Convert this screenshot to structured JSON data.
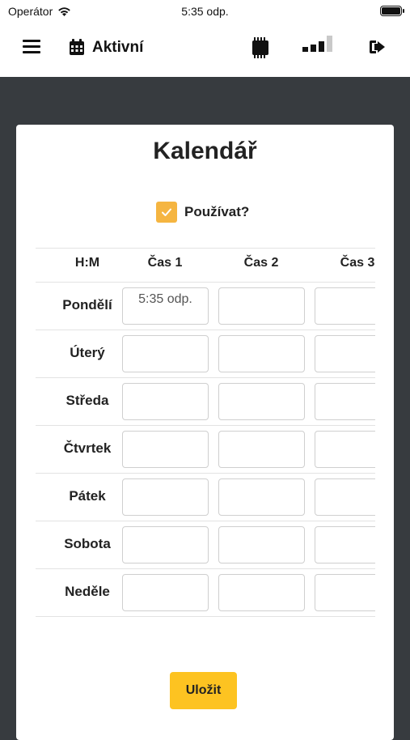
{
  "status_bar": {
    "carrier": "Operátor",
    "time": "5:35 odp."
  },
  "app_bar": {
    "title": "Aktivní",
    "icons": [
      "menu-icon",
      "calendar-icon",
      "chip-icon",
      "signal-icon",
      "logout-icon"
    ]
  },
  "calendar": {
    "title": "Kalendář",
    "use_label": "Používat?",
    "use_checked": true,
    "header_label": "H:M",
    "columns": [
      "Čas 1",
      "Čas 2",
      "Čas 3"
    ],
    "days": [
      "Pondělí",
      "Úterý",
      "Středa",
      "Čtvrtek",
      "Pátek",
      "Sobota",
      "Neděle"
    ],
    "values": [
      [
        "5:35 odp.",
        "",
        ""
      ],
      [
        "",
        "",
        ""
      ],
      [
        "",
        "",
        ""
      ],
      [
        "",
        "",
        ""
      ],
      [
        "",
        "",
        ""
      ],
      [
        "",
        "",
        ""
      ],
      [
        "",
        "",
        ""
      ]
    ]
  },
  "save_label": "Uložit",
  "colors": {
    "checkbox": "#f5b541",
    "save_button": "#fdc321",
    "background": "#373b3f"
  }
}
